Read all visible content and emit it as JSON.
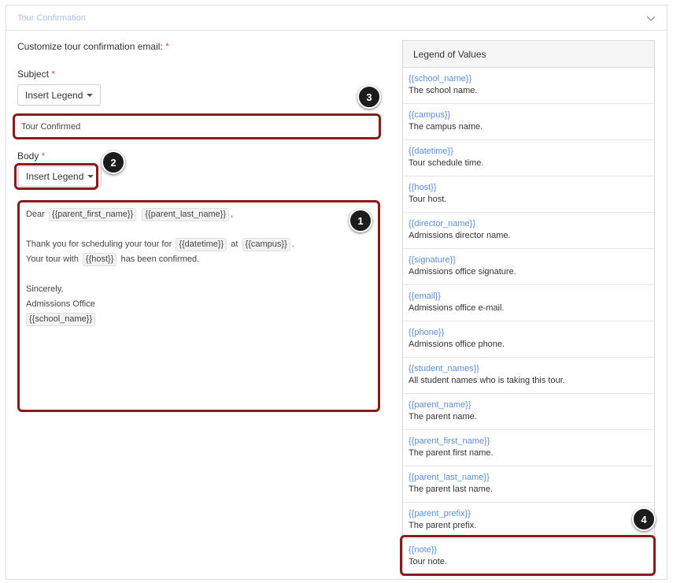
{
  "panel": {
    "title": "Tour Confirmation"
  },
  "form": {
    "customize_label": "Customize tour confirmation email:",
    "required_mark": "*",
    "subject_label": "Subject",
    "insert_legend_label": "Insert Legend",
    "subject_value": "Tour Confirmed",
    "body_label": "Body"
  },
  "body": {
    "greeting": "Dear",
    "token_parent_first_name": "{{parent_first_name}}",
    "token_parent_last_name": "{{parent_last_name}}",
    "comma": ",",
    "line2_text": "Thank you for scheduling your tour for",
    "token_datetime": "{{datetime}}",
    "at": "at",
    "token_campus": "{{campus}}",
    "period": ".",
    "line3_text": "Your tour with",
    "token_host": "{{host}}",
    "line3_end": "has been confirmed.",
    "closing": "Sincerely,",
    "signature": "Admissions Office",
    "token_school_name": "{{school_name}}"
  },
  "legend": {
    "title": "Legend of Values",
    "items": [
      {
        "key": "{{school_name}}",
        "desc": "The school name."
      },
      {
        "key": "{{campus}}",
        "desc": "The campus name."
      },
      {
        "key": "{{datetime}}",
        "desc": "Tour schedule time."
      },
      {
        "key": "{{host}}",
        "desc": "Tour host."
      },
      {
        "key": "{{director_name}}",
        "desc": "Admissions director name."
      },
      {
        "key": "{{signature}}",
        "desc": "Admissions office signature."
      },
      {
        "key": "{{email}}",
        "desc": "Admissions office e-mail."
      },
      {
        "key": "{{phone}}",
        "desc": "Admissions office phone."
      },
      {
        "key": "{{student_names}}",
        "desc": "All student names who is taking this tour."
      },
      {
        "key": "{{parent_name}}",
        "desc": "The parent name."
      },
      {
        "key": "{{parent_first_name}}",
        "desc": "The parent first name."
      },
      {
        "key": "{{parent_last_name}}",
        "desc": "The parent last name."
      },
      {
        "key": "{{parent_prefix}}",
        "desc": "The parent prefix."
      },
      {
        "key": "{{note}}",
        "desc": "Tour note."
      }
    ]
  },
  "badges": {
    "b1": "1",
    "b2": "2",
    "b3": "3",
    "b4": "4"
  },
  "colors": {
    "highlight": "#8b1a1a",
    "legend_key": "#5a8fd6",
    "title": "#a9c4e4",
    "required": "#d9534f"
  },
  "icons": {
    "collapse": "chevron-down-icon",
    "dropdown": "caret-down-icon"
  }
}
